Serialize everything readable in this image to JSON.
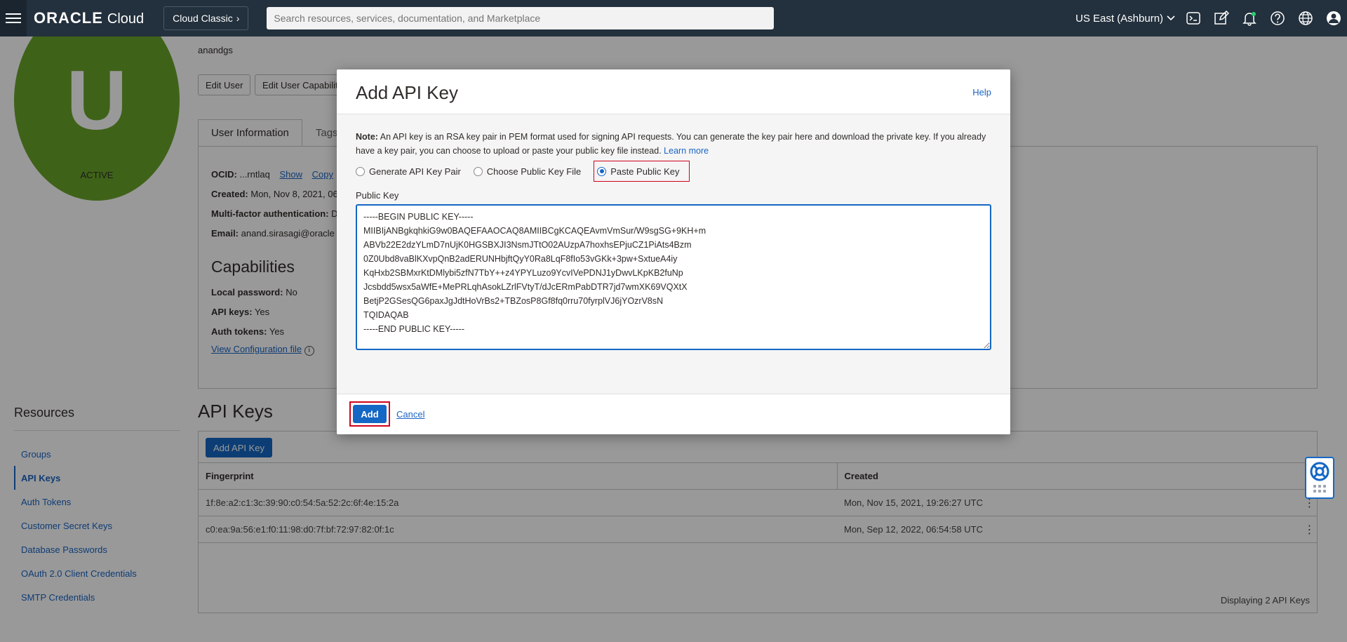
{
  "topbar": {
    "logo_oracle": "ORACLE",
    "logo_cloud": "Cloud",
    "cloud_classic": "Cloud Classic",
    "search_placeholder": "Search resources, services, documentation, and Marketplace",
    "region": "US East (Ashburn)",
    "icons": [
      "menu-icon",
      "terminal-icon",
      "edit-icon",
      "bell-icon",
      "help-icon",
      "globe-icon",
      "user-icon"
    ]
  },
  "profile": {
    "initial": "U",
    "status": "ACTIVE",
    "username": "anandgs",
    "edit_user": "Edit User",
    "edit_capabilities": "Edit User Capabilities"
  },
  "info": {
    "tabs": [
      "User Information",
      "Tags"
    ],
    "ocid_label": "OCID:",
    "ocid_value": "...rntlaq",
    "ocid_show": "Show",
    "ocid_copy": "Copy",
    "created_label": "Created:",
    "created_value": "Mon, Nov 8, 2021, 06",
    "mfa_label": "Multi-factor authentication:",
    "mfa_value": "D",
    "email_label": "Email:",
    "email_value": "anand.sirasagi@oracle",
    "capabilities_title": "Capabilities",
    "local_pw_label": "Local password:",
    "local_pw_value": "No",
    "api_keys_label": "API keys:",
    "api_keys_value": "Yes",
    "auth_tokens_label": "Auth tokens:",
    "auth_tokens_value": "Yes",
    "view_config": "View Configuration file"
  },
  "resources": {
    "title": "Resources",
    "items": [
      "Groups",
      "API Keys",
      "Auth Tokens",
      "Customer Secret Keys",
      "Database Passwords",
      "OAuth 2.0 Client Credentials",
      "SMTP Credentials"
    ]
  },
  "api_keys": {
    "title": "API Keys",
    "add_button": "Add API Key",
    "columns": [
      "Fingerprint",
      "Created"
    ],
    "rows": [
      {
        "fingerprint": "1f:8e:a2:c1:3c:39:90:c0:54:5a:52:2c:6f:4e:15:2a",
        "created": "Mon, Nov 15, 2021, 19:26:27 UTC"
      },
      {
        "fingerprint": "c0:ea:9a:56:e1:f0:11:98:d0:7f:bf:72:97:82:0f:1c",
        "created": "Mon, Sep 12, 2022, 06:54:58 UTC"
      }
    ],
    "displaying": "Displaying 2 API Keys"
  },
  "modal": {
    "title": "Add API Key",
    "help": "Help",
    "note_label": "Note:",
    "note_text": " An API key is an RSA key pair in PEM format used for signing API requests. You can generate the key pair here and download the private key. If you already have a key pair, you can choose to upload or paste your public key file instead. ",
    "learn_more": "Learn more",
    "options": [
      "Generate API Key Pair",
      "Choose Public Key File",
      "Paste Public Key"
    ],
    "selected_option": "Paste Public Key",
    "public_key_label": "Public Key",
    "public_key_value": "-----BEGIN PUBLIC KEY-----\nMIIBIjANBgkqhkiG9w0BAQEFAAOCAQ8AMIIBCgKCAQEAvmVmSur/W9sgSG+9KH+m\nABVb22E2dzYLmD7nUjK0HGSBXJI3NsmJTtO02AUzpA7hoxhsEPjuCZ1PiAts4Bzm\n0Z0Ubd8vaBlKXvpQnB2adERUNHbjftQyY0Ra8LqF8fIo53vGKk+3pw+SxtueA4iy\nKqHxb2SBMxrKtDMlybi5zfN7TbY++z4YPYLuzo9YcvIVePDNJ1yDwvLKpKB2fuNp\nJcsbdd5wsx5aWfE+MePRLqhAsokLZrlFVtyT/dJcERmPabDTR7jd7wmXK69VQXtX\nBetjP2GSesQG6paxJgJdtHoVrBs2+TBZosP8Gf8fq0rru70fyrplVJ6jYOzrV8sN\nTQIDAQAB\n-----END PUBLIC KEY-----",
    "add": "Add",
    "cancel": "Cancel"
  },
  "colors": {
    "topbar": "#23303d",
    "accent": "#1467c4",
    "highlight": "#d0021b",
    "avatar": "#6aa32b"
  }
}
